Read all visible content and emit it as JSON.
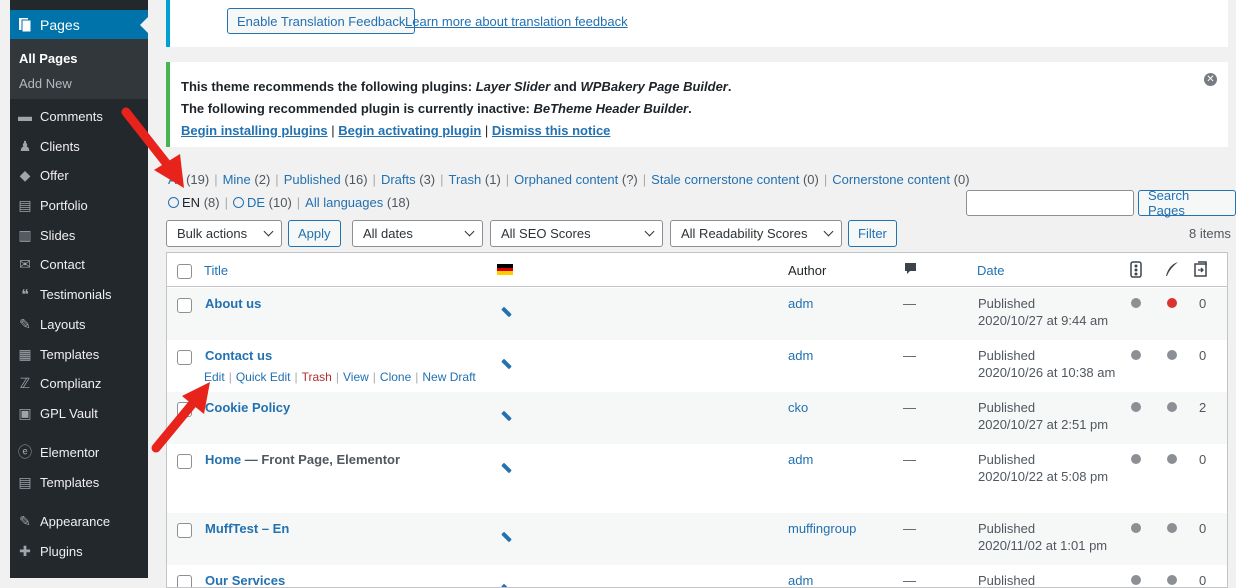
{
  "sidebar": {
    "active": "Pages",
    "submenu": [
      "All Pages",
      "Add New"
    ],
    "items": [
      {
        "label": "Comments",
        "icon": "comments-icon"
      },
      {
        "label": "Clients",
        "icon": "clients-icon"
      },
      {
        "label": "Offer",
        "icon": "offer-icon"
      },
      {
        "label": "Portfolio",
        "icon": "portfolio-icon"
      },
      {
        "label": "Slides",
        "icon": "slides-icon"
      },
      {
        "label": "Contact",
        "icon": "contact-icon"
      },
      {
        "label": "Testimonials",
        "icon": "testimonials-icon"
      },
      {
        "label": "Layouts",
        "icon": "layouts-icon"
      },
      {
        "label": "Templates",
        "icon": "templates-icon"
      },
      {
        "label": "Complianz",
        "icon": "complianz-icon"
      },
      {
        "label": "GPL Vault",
        "icon": "gpl-vault-icon"
      },
      {
        "label": "Elementor",
        "icon": "elementor-icon"
      },
      {
        "label": "Templates",
        "icon": "folder-icon"
      },
      {
        "label": "Appearance",
        "icon": "appearance-icon"
      },
      {
        "label": "Plugins",
        "icon": "plugins-icon"
      }
    ]
  },
  "notice1": {
    "button": "Enable Translation Feedback",
    "link": "Learn more about translation feedback"
  },
  "notice2": {
    "line1_pre": "This theme recommends the following plugins: ",
    "line1_p1": "Layer Slider",
    "line1_and": " and ",
    "line1_p2": "WPBakery Page Builder",
    "line1_end": ".",
    "line2_pre": "The following recommended plugin is currently inactive: ",
    "line2_p": "BeTheme Header Builder",
    "line2_end": ".",
    "link_install": "Begin installing plugins",
    "link_activate": "Begin activating plugin",
    "link_dismiss": "Dismiss this notice",
    "sep": "|"
  },
  "filters": {
    "all": "All",
    "all_count": "(19)",
    "mine": "Mine",
    "mine_count": "(2)",
    "published": "Published",
    "published_count": "(16)",
    "drafts": "Drafts",
    "drafts_count": "(3)",
    "trash": "Trash",
    "trash_count": "(1)",
    "orphaned": "Orphaned content",
    "orphaned_count": "(?)",
    "stale": "Stale cornerstone content",
    "stale_count": "(0)",
    "cornerstone": "Cornerstone content",
    "cornerstone_count": "(0)",
    "sep": "|"
  },
  "languages": {
    "en": "EN",
    "en_count": "(8)",
    "de": "DE",
    "de_count": "(10)",
    "all": "All languages",
    "all_count": "(18)"
  },
  "search": {
    "button": "Search Pages"
  },
  "toolbar": {
    "bulk": "Bulk actions",
    "apply": "Apply",
    "dates": "All dates",
    "seo": "All SEO Scores",
    "readability": "All Readability Scores",
    "filter": "Filter",
    "items": "8 items"
  },
  "table": {
    "headers": {
      "title": "Title",
      "author": "Author",
      "date": "Date"
    },
    "row_actions": {
      "edit": "Edit",
      "quick_edit": "Quick Edit",
      "trash": "Trash",
      "view": "View",
      "clone": "Clone",
      "new_draft": "New Draft",
      "sep": "|"
    },
    "rows": [
      {
        "title": "About us",
        "suffix": "",
        "author": "adm",
        "comments": "—",
        "status": "Published",
        "date": "2020/10/27 at 9:44 am",
        "seo_color": "#8c8f94",
        "read_color": "#dc3232",
        "links": "0"
      },
      {
        "title": "Contact us",
        "suffix": "",
        "author": "adm",
        "comments": "—",
        "status": "Published",
        "date": "2020/10/26 at 10:38 am",
        "seo_color": "#8c8f94",
        "read_color": "#8c8f94",
        "links": "0"
      },
      {
        "title": "Cookie Policy",
        "suffix": "",
        "author": "cko",
        "comments": "—",
        "status": "Published",
        "date": "2020/10/27 at 2:51 pm",
        "seo_color": "#8c8f94",
        "read_color": "#8c8f94",
        "links": "2"
      },
      {
        "title": "Home",
        "suffix": " — Front Page, Elementor",
        "author": "adm",
        "comments": "—",
        "status": "Published",
        "date": "2020/10/22 at 5:08 pm",
        "seo_color": "#8c8f94",
        "read_color": "#8c8f94",
        "links": "0"
      },
      {
        "title": "MuffTest – En",
        "suffix": "",
        "author": "muffingroup",
        "comments": "—",
        "status": "Published",
        "date": "2020/11/02 at 1:01 pm",
        "seo_color": "#8c8f94",
        "read_color": "#8c8f94",
        "links": "0"
      },
      {
        "title": "Our Services",
        "suffix": "",
        "author": "adm",
        "comments": "—",
        "status": "Published",
        "date": "",
        "seo_color": "#8c8f94",
        "read_color": "#8c8f94",
        "links": "0"
      }
    ]
  }
}
